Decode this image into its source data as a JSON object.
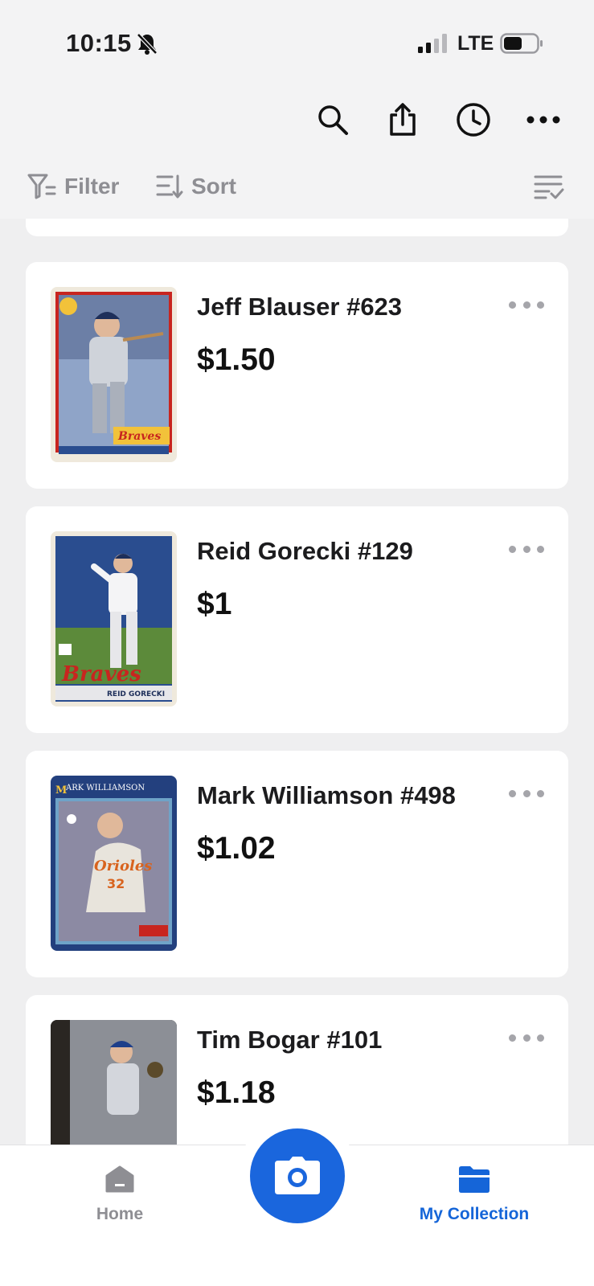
{
  "status_bar": {
    "time": "10:15",
    "network": "LTE",
    "icons": [
      "bell-off-icon",
      "signal-icon",
      "battery-icon"
    ]
  },
  "toolbar": {
    "icons": [
      "search-icon",
      "share-icon",
      "history-clock-icon",
      "more-icon"
    ]
  },
  "filter_bar": {
    "filter_label": "Filter",
    "sort_label": "Sort",
    "select_icon": "checklist-icon"
  },
  "cards": [
    {
      "title": "Jeff Blauser #623",
      "price": "$1.50",
      "thumb_colors": [
        "#3a5a9a",
        "#9b9fa8",
        "#c8251f",
        "#f2c23a"
      ]
    },
    {
      "title": "Reid Gorecki #129",
      "price": "$1",
      "thumb_colors": [
        "#2a4d8f",
        "#5c8a3a",
        "#c8251f",
        "#e7e7ea"
      ]
    },
    {
      "title": "Mark Williamson #498",
      "price": "$1.02",
      "thumb_colors": [
        "#23407e",
        "#6fa3c8",
        "#e8e4dc",
        "#d8631e"
      ]
    },
    {
      "title": "Tim Bogar #101",
      "price": "$1.18",
      "thumb_colors": [
        "#3a3530",
        "#8c8f96",
        "#1e3f8a",
        "#5b6b4a"
      ]
    }
  ],
  "tab_bar": {
    "home_label": "Home",
    "collection_label": "My Collection",
    "accent_color": "#1a66dd",
    "inactive_color": "#8e8e93"
  }
}
